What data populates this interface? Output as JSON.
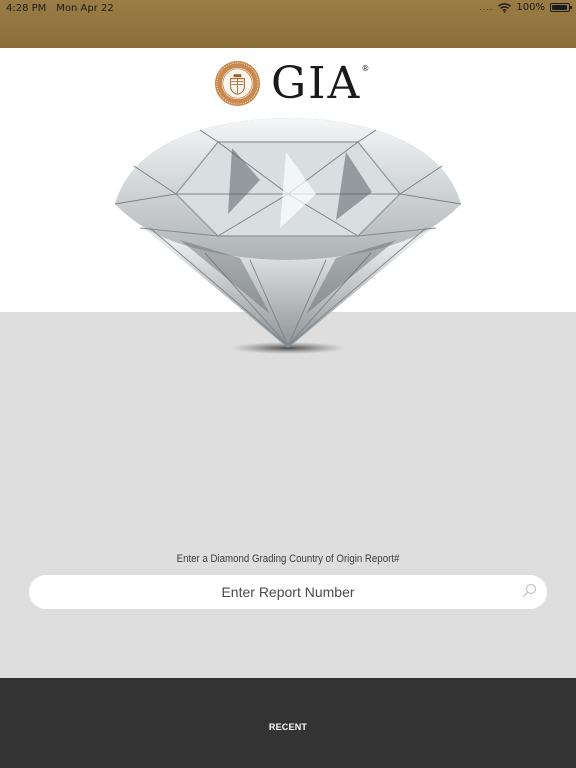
{
  "status_bar": {
    "time": "4:28 PM",
    "date": "Mon Apr 22",
    "signal_dots": "....",
    "battery": "100%",
    "background": "#8f7340"
  },
  "logo": {
    "wordmark": "GIA",
    "registered": "®",
    "accent_color": "#b9763a"
  },
  "hero": {
    "image": "diamond-image"
  },
  "search": {
    "prompt": "Enter a Diamond Grading Country of Origin Report#",
    "placeholder": "Enter Report Number",
    "value": ""
  },
  "footer": {
    "recent_label": "RECENT",
    "background": "#333333"
  }
}
